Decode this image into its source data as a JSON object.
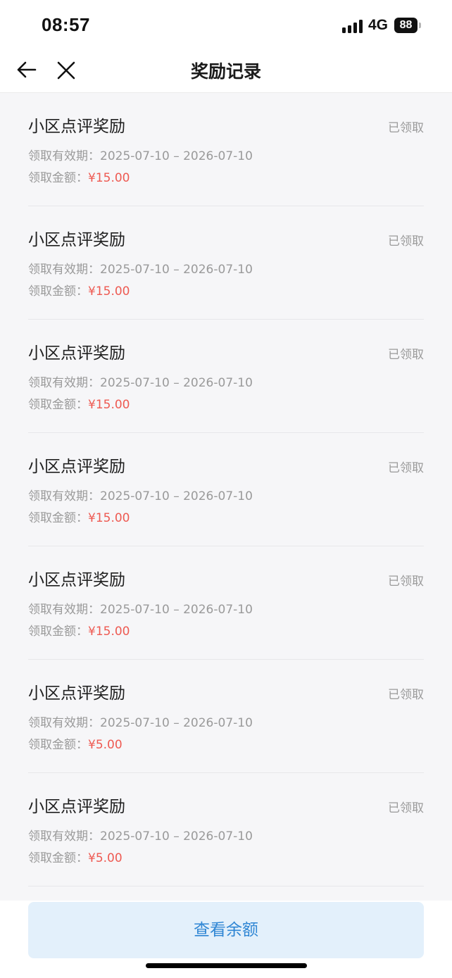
{
  "status_bar": {
    "time": "08:57",
    "network": "4G",
    "battery": "88"
  },
  "nav": {
    "title": "奖励记录",
    "back_icon": "arrow-left-icon",
    "close_icon": "close-icon"
  },
  "records": [
    {
      "title": "小区点评奖励",
      "status": "已领取",
      "validity_label": "领取有效期：",
      "validity": "2025-07-10 – 2026-07-10",
      "amount_label": "领取金额：",
      "amount": "¥15.00"
    },
    {
      "title": "小区点评奖励",
      "status": "已领取",
      "validity_label": "领取有效期：",
      "validity": "2025-07-10 – 2026-07-10",
      "amount_label": "领取金额：",
      "amount": "¥15.00"
    },
    {
      "title": "小区点评奖励",
      "status": "已领取",
      "validity_label": "领取有效期：",
      "validity": "2025-07-10 – 2026-07-10",
      "amount_label": "领取金额：",
      "amount": "¥15.00"
    },
    {
      "title": "小区点评奖励",
      "status": "已领取",
      "validity_label": "领取有效期：",
      "validity": "2025-07-10 – 2026-07-10",
      "amount_label": "领取金额：",
      "amount": "¥15.00"
    },
    {
      "title": "小区点评奖励",
      "status": "已领取",
      "validity_label": "领取有效期：",
      "validity": "2025-07-10 – 2026-07-10",
      "amount_label": "领取金额：",
      "amount": "¥15.00"
    },
    {
      "title": "小区点评奖励",
      "status": "已领取",
      "validity_label": "领取有效期：",
      "validity": "2025-07-10 – 2026-07-10",
      "amount_label": "领取金额：",
      "amount": "¥5.00"
    },
    {
      "title": "小区点评奖励",
      "status": "已领取",
      "validity_label": "领取有效期：",
      "validity": "2025-07-10 – 2026-07-10",
      "amount_label": "领取金额：",
      "amount": "¥5.00"
    }
  ],
  "footer": {
    "balance_button": "查看余额"
  },
  "colors": {
    "amount": "#ee5a52",
    "button_bg": "#e3f0fb",
    "button_text": "#2f86d4",
    "page_bg": "#f6f6f8"
  }
}
